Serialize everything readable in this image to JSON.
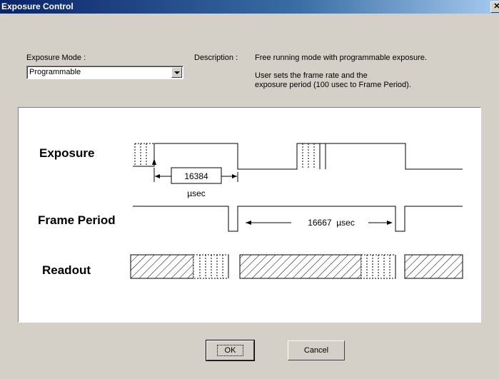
{
  "dialog": {
    "title": "Exposure Control",
    "close_glyph": "✕"
  },
  "mode": {
    "label": "Exposure Mode :",
    "selected": "Programmable"
  },
  "description": {
    "label": "Description :",
    "line1": "Free running mode with programmable exposure.",
    "line2": "User sets the frame rate and the",
    "line3": "exposure period (100 usec to Frame Period)."
  },
  "diagram": {
    "exposure_label": "Exposure",
    "frame_period_label": "Frame Period",
    "readout_label": "Readout",
    "exposure_value": "16384",
    "exposure_unit": "µsec",
    "frame_period_text": "16667  µsec"
  },
  "buttons": {
    "ok": "OK",
    "cancel": "Cancel"
  }
}
